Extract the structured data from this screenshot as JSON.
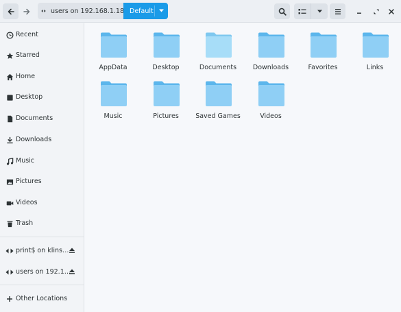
{
  "header": {
    "path_label": "users on 192.168.1.18",
    "default_label": "Default"
  },
  "sidebar": {
    "places": [
      {
        "label": "Recent",
        "icon": "clock-icon"
      },
      {
        "label": "Starred",
        "icon": "star-icon"
      },
      {
        "label": "Home",
        "icon": "home-icon"
      },
      {
        "label": "Desktop",
        "icon": "desktop-icon"
      },
      {
        "label": "Documents",
        "icon": "document-icon"
      },
      {
        "label": "Downloads",
        "icon": "download-icon"
      },
      {
        "label": "Music",
        "icon": "music-icon"
      },
      {
        "label": "Pictures",
        "icon": "picture-icon"
      },
      {
        "label": "Videos",
        "icon": "video-icon"
      },
      {
        "label": "Trash",
        "icon": "trash-icon"
      }
    ],
    "mounts": [
      {
        "label": "print$ on klins…",
        "icon": "network-icon"
      },
      {
        "label": "users on 192.1…",
        "icon": "network-icon"
      }
    ],
    "other": {
      "label": "Other Locations",
      "icon": "plus-icon"
    }
  },
  "files": [
    {
      "name": "AppData"
    },
    {
      "name": "Desktop"
    },
    {
      "name": "Documents"
    },
    {
      "name": "Downloads"
    },
    {
      "name": "Favorites"
    },
    {
      "name": "Links"
    },
    {
      "name": "Music"
    },
    {
      "name": "Pictures"
    },
    {
      "name": "Saved Games"
    },
    {
      "name": "Videos"
    }
  ],
  "colors": {
    "accent": "#1a9be8",
    "folder": "#8fcff5",
    "folder_tab": "#5cb6ec"
  }
}
